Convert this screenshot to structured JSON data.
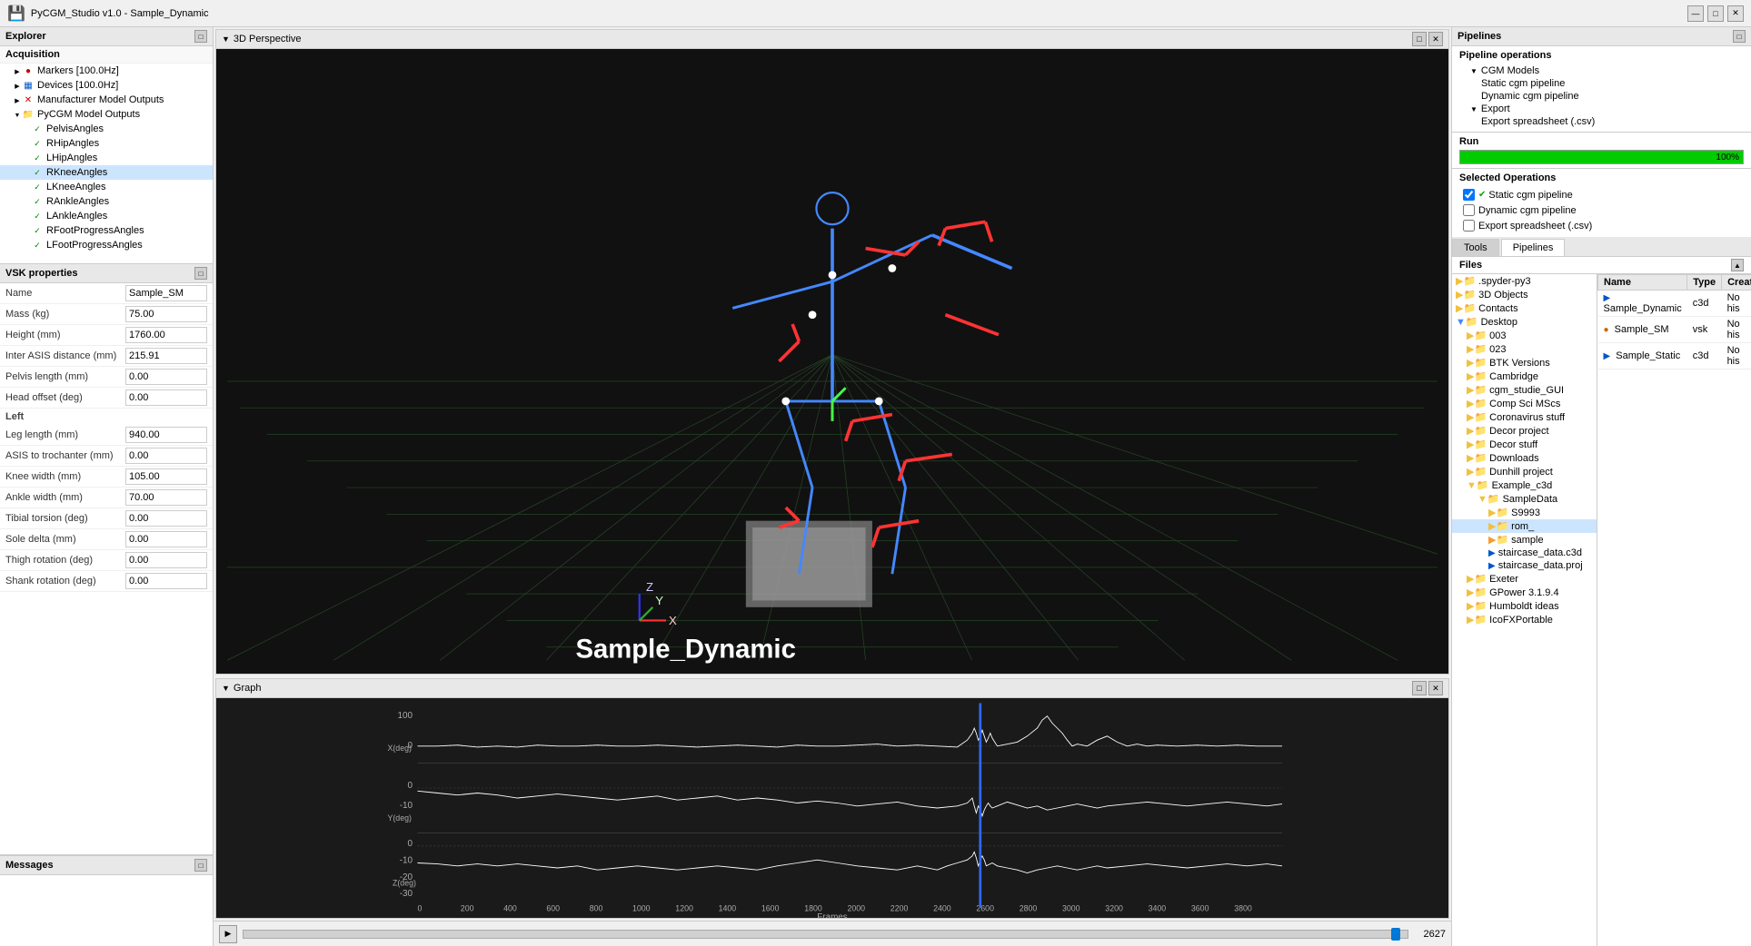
{
  "window": {
    "title": "PyCGM_Studio v1.0 - Sample_Dynamic",
    "controls": [
      "—",
      "□",
      "✕"
    ]
  },
  "toolbar": {
    "save_icon": "💾"
  },
  "explorer": {
    "title": "Explorer",
    "acquisition": {
      "label": "Acquisition",
      "items": [
        {
          "id": "markers",
          "label": "Markers [100.0Hz]",
          "indent": 1,
          "icon": "red_circle",
          "arrow": "right"
        },
        {
          "id": "devices",
          "label": "Devices [100.0Hz]",
          "indent": 1,
          "icon": "blue_grid",
          "arrow": "right"
        },
        {
          "id": "manufacturer",
          "label": "Manufacturer Model Outputs",
          "indent": 1,
          "icon": "x",
          "arrow": "right"
        },
        {
          "id": "pycgm",
          "label": "PyCGM Model Outputs",
          "indent": 1,
          "icon": "folder",
          "arrow": "down"
        },
        {
          "id": "pelvis",
          "label": "PelvisAngles",
          "indent": 2,
          "icon": "check",
          "arrow": "none"
        },
        {
          "id": "rhip",
          "label": "RHipAngles",
          "indent": 2,
          "icon": "check",
          "arrow": "none"
        },
        {
          "id": "lhip",
          "label": "LHipAngles",
          "indent": 2,
          "icon": "check",
          "arrow": "none"
        },
        {
          "id": "rknee",
          "label": "RKneeAngles",
          "indent": 2,
          "icon": "check",
          "arrow": "none",
          "selected": true
        },
        {
          "id": "lknee",
          "label": "LKneeAngles",
          "indent": 2,
          "icon": "check",
          "arrow": "none"
        },
        {
          "id": "rankle",
          "label": "RAnkleAngles",
          "indent": 2,
          "icon": "check",
          "arrow": "none"
        },
        {
          "id": "lankle",
          "label": "LAnkleAngles",
          "indent": 2,
          "icon": "check",
          "arrow": "none"
        },
        {
          "id": "rfootprogress",
          "label": "RFootProgressAngles",
          "indent": 2,
          "icon": "check",
          "arrow": "none"
        },
        {
          "id": "lfootprogress",
          "label": "LFootProgressAngles",
          "indent": 2,
          "icon": "check",
          "arrow": "none"
        }
      ]
    },
    "vsk_properties": {
      "title": "VSK properties",
      "fields": [
        {
          "label": "Name",
          "value": "Sample_SM",
          "key": "name"
        },
        {
          "label": "Mass (kg)",
          "value": "75.00",
          "key": "mass"
        },
        {
          "label": "Height (mm)",
          "value": "1760.00",
          "key": "height"
        },
        {
          "label": "Inter ASIS distance (mm)",
          "value": "215.91",
          "key": "inter_asis"
        },
        {
          "label": "Pelvis length (mm)",
          "value": "0.00",
          "key": "pelvis_length"
        },
        {
          "label": "Head offset (deg)",
          "value": "0.00",
          "key": "head_offset"
        },
        {
          "label": "Left",
          "section": true
        },
        {
          "label": "Leg length (mm)",
          "value": "940.00",
          "key": "leg_length"
        },
        {
          "label": "ASIS to trochanter (mm)",
          "value": "0.00",
          "key": "asis_trochanter"
        },
        {
          "label": "Knee width (mm)",
          "value": "105.00",
          "key": "knee_width"
        },
        {
          "label": "Ankle width (mm)",
          "value": "70.00",
          "key": "ankle_width"
        },
        {
          "label": "Tibial torsion (deg)",
          "value": "0.00",
          "key": "tibial_torsion"
        },
        {
          "label": "Sole delta (mm)",
          "value": "0.00",
          "key": "sole_delta"
        },
        {
          "label": "Thigh rotation (deg)",
          "value": "0.00",
          "key": "thigh_rotation"
        },
        {
          "label": "Shank rotation (deg)",
          "value": "0.00",
          "key": "shank_rotation"
        }
      ]
    },
    "messages": {
      "title": "Messages"
    }
  },
  "viewport_3d": {
    "title": "3D Perspective",
    "label": "Sample_Dynamic",
    "controls": [
      "□",
      "✕"
    ]
  },
  "graph": {
    "title": "Graph",
    "controls": [
      "□",
      "✕"
    ],
    "y_labels": [
      "100",
      "0",
      "0",
      "-10",
      "-20",
      "-30"
    ],
    "x_labels": [
      "0",
      "200",
      "400",
      "600",
      "800",
      "1000",
      "1200",
      "1400",
      "1600",
      "1800",
      "2000",
      "2200",
      "2400",
      "2600",
      "2800",
      "3000",
      "3200",
      "3400",
      "3600",
      "3800"
    ],
    "axis_labels": [
      "X(deg)",
      "Y(deg)",
      "Z(deg)"
    ],
    "frames_label": "Frames",
    "cursor_frame": 2627
  },
  "playback": {
    "play_icon": "▶",
    "frame_count": "2627",
    "thumb_pct": 99.5
  },
  "pipelines": {
    "title": "Pipelines",
    "operations_title": "Pipeline operations",
    "cgm_models_label": "CGM Models",
    "cgm_items": [
      {
        "label": "Static cgm pipeline"
      },
      {
        "label": "Dynamic cgm pipeline"
      }
    ],
    "export_label": "Export",
    "export_items": [
      {
        "label": "Export spreadsheet (.csv)"
      }
    ],
    "run_label": "Run",
    "progress_pct": "100%",
    "selected_ops_title": "Selected Operations",
    "operations": [
      {
        "label": "Static cgm pipeline",
        "checked": true,
        "check_icon": true
      },
      {
        "label": "Dynamic cgm pipeline",
        "checked": false,
        "check_icon": false
      },
      {
        "label": "Export spreadsheet (.csv)",
        "checked": false,
        "check_icon": false
      }
    ],
    "tabs": [
      "Tools",
      "Pipelines"
    ],
    "active_tab": "Pipelines"
  },
  "files": {
    "title": "Files",
    "left_items": [
      {
        "label": ".spyder-py3",
        "indent": 0,
        "type": "folder"
      },
      {
        "label": "3D Objects",
        "indent": 0,
        "type": "folder"
      },
      {
        "label": "Contacts",
        "indent": 0,
        "type": "folder"
      },
      {
        "label": "Desktop",
        "indent": 0,
        "type": "folder_blue",
        "expanded": true
      },
      {
        "label": "003",
        "indent": 1,
        "type": "folder"
      },
      {
        "label": "023",
        "indent": 1,
        "type": "folder"
      },
      {
        "label": "BTK Versions",
        "indent": 1,
        "type": "folder"
      },
      {
        "label": "Cambridge",
        "indent": 1,
        "type": "folder"
      },
      {
        "label": "cgm_studie_GUI",
        "indent": 1,
        "type": "folder"
      },
      {
        "label": "Comp Sci MScs",
        "indent": 1,
        "type": "folder"
      },
      {
        "label": "Coronavirus stuff",
        "indent": 1,
        "type": "folder"
      },
      {
        "label": "Decor project",
        "indent": 1,
        "type": "folder"
      },
      {
        "label": "Decor stuff",
        "indent": 1,
        "type": "folder"
      },
      {
        "label": "Downloads",
        "indent": 1,
        "type": "folder"
      },
      {
        "label": "Dunhill project",
        "indent": 1,
        "type": "folder"
      },
      {
        "label": "Example_c3d",
        "indent": 1,
        "type": "folder",
        "expanded": true
      },
      {
        "label": "SampleData",
        "indent": 2,
        "type": "folder",
        "expanded": true
      },
      {
        "label": "S9993",
        "indent": 3,
        "type": "folder"
      },
      {
        "label": "rom_",
        "indent": 3,
        "type": "folder",
        "selected": true
      },
      {
        "label": "sample",
        "indent": 3,
        "type": "folder_orange"
      },
      {
        "label": "staircase_data.c3d",
        "indent": 3,
        "type": "file_c3d"
      },
      {
        "label": "staircase_data.proj",
        "indent": 3,
        "type": "file_proj"
      },
      {
        "label": "Exeter",
        "indent": 1,
        "type": "folder"
      },
      {
        "label": "GPower 3.1.9.4",
        "indent": 1,
        "type": "folder"
      },
      {
        "label": "Humboldt ideas",
        "indent": 1,
        "type": "folder"
      },
      {
        "label": "IcoFXPortable",
        "indent": 1,
        "type": "folder"
      }
    ],
    "right_columns": [
      "Name",
      "Type",
      "Creat"
    ],
    "right_items": [
      {
        "name": "Sample_Dynamic",
        "type": "c3d",
        "created": "No his",
        "icon": "c3d"
      },
      {
        "name": "Sample_SM",
        "type": "vsk",
        "created": "No his",
        "icon": "vsk"
      },
      {
        "name": "Sample_Static",
        "type": "c3d",
        "created": "No his",
        "icon": "c3d"
      }
    ]
  }
}
